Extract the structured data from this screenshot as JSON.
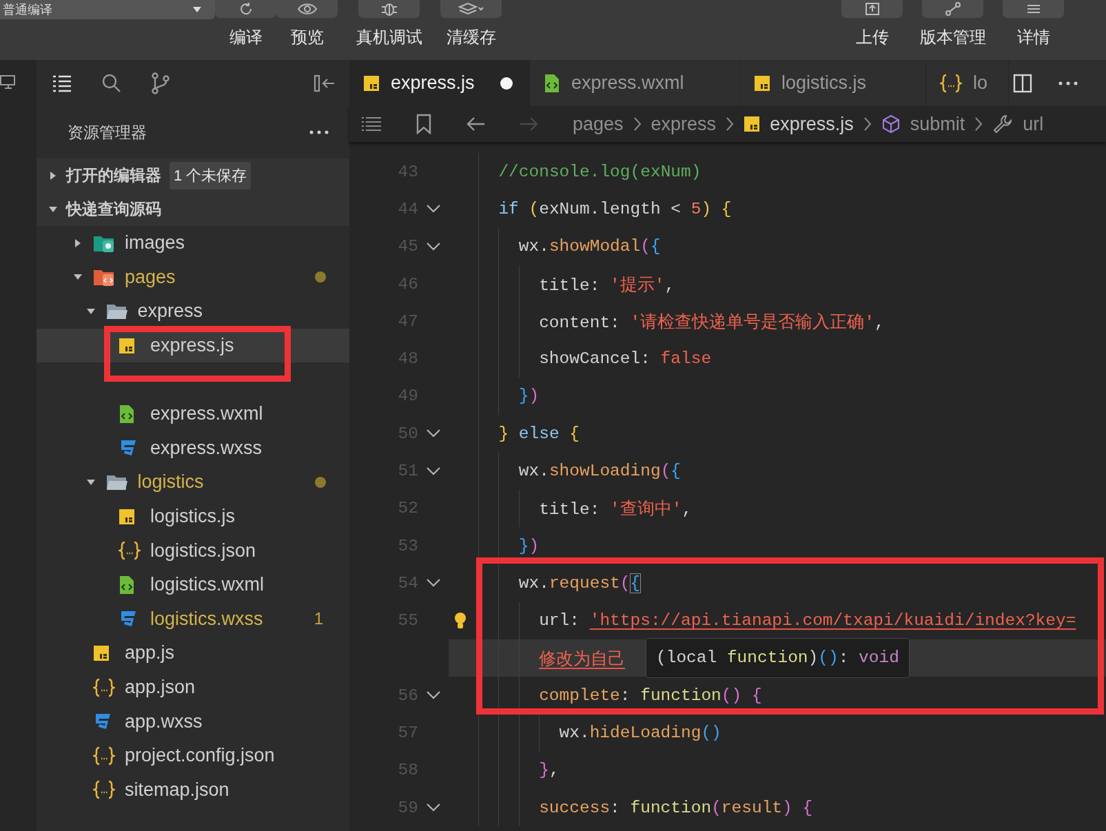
{
  "toolbar": {
    "compile_mode": "普通编译",
    "left_tools": [
      {
        "label": "编译",
        "kind": "refresh"
      },
      {
        "label": "预览",
        "kind": "eye"
      },
      {
        "label": "真机调试",
        "kind": "bug"
      },
      {
        "label": "清缓存",
        "kind": "layers"
      }
    ],
    "right_tools": [
      {
        "label": "上传",
        "kind": "upload"
      },
      {
        "label": "版本管理",
        "kind": "branch"
      },
      {
        "label": "详情",
        "kind": "menu"
      }
    ]
  },
  "sidebar": {
    "title": "资源管理器",
    "sections": [
      {
        "label": "打开的编辑器",
        "expanded": false,
        "badge": "1 个未保存"
      },
      {
        "label": "快递查询源码",
        "expanded": true
      }
    ],
    "tree": [
      {
        "name": "images",
        "kind": "folder-images",
        "expanded": false,
        "selected": false,
        "modified": false,
        "annotated": false
      },
      {
        "name": "pages",
        "kind": "folder-pages",
        "expanded": true,
        "selected": false,
        "modified": true,
        "annotated": false,
        "children": [
          {
            "name": "express",
            "kind": "folder",
            "expanded": true,
            "selected": false,
            "modified": false,
            "annotated": false,
            "children": [
              {
                "name": "express.js",
                "kind": "js",
                "selected": true,
                "modified": false,
                "annotated": true
              },
              {
                "name": "express.wxml",
                "kind": "wxml",
                "selected": false,
                "modified": false,
                "annotated": false
              },
              {
                "name": "express.wxss",
                "kind": "wxss",
                "selected": false,
                "modified": false,
                "annotated": false
              }
            ]
          },
          {
            "name": "logistics",
            "kind": "folder",
            "expanded": true,
            "selected": false,
            "modified": true,
            "annotated": false,
            "children": [
              {
                "name": "logistics.js",
                "kind": "js",
                "selected": false,
                "modified": false,
                "annotated": false
              },
              {
                "name": "logistics.json",
                "kind": "json",
                "selected": false,
                "modified": false,
                "annotated": false
              },
              {
                "name": "logistics.wxml",
                "kind": "wxml",
                "selected": false,
                "modified": false,
                "annotated": false
              },
              {
                "name": "logistics.wxss",
                "kind": "wxss",
                "selected": false,
                "modified": true,
                "annotated": false,
                "badge": "1"
              }
            ]
          }
        ]
      },
      {
        "name": "app.js",
        "kind": "js",
        "selected": false,
        "modified": false,
        "annotated": false
      },
      {
        "name": "app.json",
        "kind": "json",
        "selected": false,
        "modified": false,
        "annotated": false
      },
      {
        "name": "app.wxss",
        "kind": "wxss",
        "selected": false,
        "modified": false,
        "annotated": false
      },
      {
        "name": "project.config.json",
        "kind": "json",
        "selected": false,
        "modified": false,
        "annotated": false
      },
      {
        "name": "sitemap.json",
        "kind": "json",
        "selected": false,
        "modified": false,
        "annotated": false
      }
    ]
  },
  "tabs": [
    {
      "label": "express.js",
      "kind": "js",
      "selected": true,
      "dirty": true
    },
    {
      "label": "express.wxml",
      "kind": "wxml",
      "selected": false,
      "dirty": false
    },
    {
      "label": "logistics.js",
      "kind": "js",
      "selected": false,
      "dirty": false
    },
    {
      "label": "lo",
      "kind": "json",
      "selected": false,
      "dirty": false
    }
  ],
  "breadcrumb": [
    {
      "label": "pages"
    },
    {
      "label": "express"
    },
    {
      "label": "express.js",
      "kind": "js"
    },
    {
      "label": "submit",
      "kind": "symbol"
    },
    {
      "label": "url",
      "kind": "wrench"
    }
  ],
  "editor": {
    "lines": [
      {
        "number": "43",
        "foldable": false,
        "annotated": false,
        "hint": false,
        "tokens": [
          {
            "kind": "comment",
            "text": "//console.log(exNum)"
          }
        ]
      },
      {
        "number": "44",
        "foldable": true,
        "annotated": false,
        "hint": false,
        "tokens": [
          {
            "kind": "kw",
            "text": "if"
          },
          {
            "kind": "p1",
            "text": " ("
          },
          {
            "kind": "plain",
            "text": "exNum.length < "
          },
          {
            "kind": "num",
            "text": "5"
          },
          {
            "kind": "p1",
            "text": ") {"
          }
        ],
        "children": [
          {
            "number": "45",
            "foldable": true,
            "annotated": false,
            "hint": false,
            "tokens": [
              {
                "kind": "plain",
                "text": "wx."
              },
              {
                "kind": "fn",
                "text": "showModal"
              },
              {
                "kind": "p2",
                "text": "("
              },
              {
                "kind": "p3",
                "text": "{"
              }
            ],
            "children": [
              {
                "number": "46",
                "foldable": false,
                "annotated": false,
                "hint": false,
                "tokens": [
                  {
                    "kind": "plain",
                    "text": "title: "
                  },
                  {
                    "kind": "str",
                    "text": "'提示'"
                  },
                  {
                    "kind": "plain",
                    "text": ","
                  }
                ]
              },
              {
                "number": "47",
                "foldable": false,
                "annotated": false,
                "hint": false,
                "tokens": [
                  {
                    "kind": "plain",
                    "text": "content: "
                  },
                  {
                    "kind": "str",
                    "text": "'请检查快递单号是否输入正确'"
                  },
                  {
                    "kind": "plain",
                    "text": ","
                  }
                ]
              },
              {
                "number": "48",
                "foldable": false,
                "annotated": false,
                "hint": false,
                "tokens": [
                  {
                    "kind": "plain",
                    "text": "showCancel: "
                  },
                  {
                    "kind": "bool",
                    "text": "false"
                  }
                ]
              }
            ]
          },
          {
            "number": "49",
            "foldable": false,
            "annotated": false,
            "hint": false,
            "tokens": [
              {
                "kind": "p3",
                "text": "}"
              },
              {
                "kind": "p2",
                "text": ")"
              }
            ]
          }
        ]
      },
      {
        "number": "50",
        "foldable": true,
        "annotated": false,
        "hint": false,
        "tokens": [
          {
            "kind": "p1",
            "text": "} "
          },
          {
            "kind": "kw",
            "text": "else"
          },
          {
            "kind": "p1",
            "text": " {"
          }
        ],
        "children": [
          {
            "number": "51",
            "foldable": true,
            "annotated": false,
            "hint": false,
            "tokens": [
              {
                "kind": "plain",
                "text": "wx."
              },
              {
                "kind": "fn",
                "text": "showLoading"
              },
              {
                "kind": "p2",
                "text": "("
              },
              {
                "kind": "p3",
                "text": "{"
              }
            ],
            "children": [
              {
                "number": "52",
                "foldable": false,
                "annotated": false,
                "hint": false,
                "tokens": [
                  {
                    "kind": "plain",
                    "text": "title: "
                  },
                  {
                    "kind": "str",
                    "text": "'查询中'"
                  },
                  {
                    "kind": "plain",
                    "text": ","
                  }
                ]
              }
            ]
          },
          {
            "number": "53",
            "foldable": false,
            "annotated": false,
            "hint": false,
            "tokens": [
              {
                "kind": "p3",
                "text": "}"
              },
              {
                "kind": "p2",
                "text": ")"
              }
            ]
          },
          {
            "number": "54",
            "foldable": true,
            "annotated": true,
            "hint": false,
            "tokens": [
              {
                "kind": "plain",
                "text": "wx."
              },
              {
                "kind": "fn",
                "text": "request"
              },
              {
                "kind": "p2",
                "text": "("
              },
              {
                "kind": "match",
                "text": "{"
              }
            ],
            "children": [
              {
                "number": "55",
                "foldable": false,
                "annotated": true,
                "hint": true,
                "tokens": [
                  {
                    "kind": "plain",
                    "text": "url: "
                  },
                  {
                    "kind": "link",
                    "text": "'https://api.tianapi.com/txapi/kuaidi/index?key="
                  }
                ]
              },
              {
                "foldable": false,
                "annotated": true,
                "hint": false,
                "tokens": [
                  {
                    "kind": "link",
                    "text": "修改为自己"
                  }
                ],
                "tooltip": [
                  {
                    "kind": "plain",
                    "text": "(local "
                  },
                  {
                    "kind": "fkw",
                    "text": "function"
                  },
                  {
                    "kind": "plain",
                    "text": ")"
                  },
                  {
                    "kind": "p3",
                    "text": "()"
                  },
                  {
                    "kind": "plain",
                    "text": ": "
                  },
                  {
                    "kind": "type",
                    "text": "void"
                  }
                ]
              },
              {
                "number": "56",
                "foldable": true,
                "annotated": true,
                "hint": false,
                "tokens": [
                  {
                    "kind": "fn",
                    "text": "complete"
                  },
                  {
                    "kind": "plain",
                    "text": ": "
                  },
                  {
                    "kind": "fkw",
                    "text": "function"
                  },
                  {
                    "kind": "p2",
                    "text": "() {"
                  }
                ],
                "children": [
                  {
                    "number": "57",
                    "foldable": false,
                    "annotated": false,
                    "hint": false,
                    "tokens": [
                      {
                        "kind": "plain",
                        "text": "wx."
                      },
                      {
                        "kind": "fn",
                        "text": "hideLoading"
                      },
                      {
                        "kind": "p3",
                        "text": "()"
                      }
                    ]
                  }
                ]
              },
              {
                "number": "58",
                "foldable": false,
                "annotated": false,
                "hint": false,
                "tokens": [
                  {
                    "kind": "p2",
                    "text": "}"
                  },
                  {
                    "kind": "plain",
                    "text": ","
                  }
                ]
              },
              {
                "number": "59",
                "foldable": true,
                "annotated": false,
                "hint": false,
                "tokens": [
                  {
                    "kind": "fn",
                    "text": "success"
                  },
                  {
                    "kind": "plain",
                    "text": ": "
                  },
                  {
                    "kind": "fkw",
                    "text": "function"
                  },
                  {
                    "kind": "p2",
                    "text": "("
                  },
                  {
                    "kind": "param",
                    "text": "result"
                  },
                  {
                    "kind": "p2",
                    "text": ") {"
                  }
                ]
              }
            ]
          }
        ]
      }
    ]
  }
}
